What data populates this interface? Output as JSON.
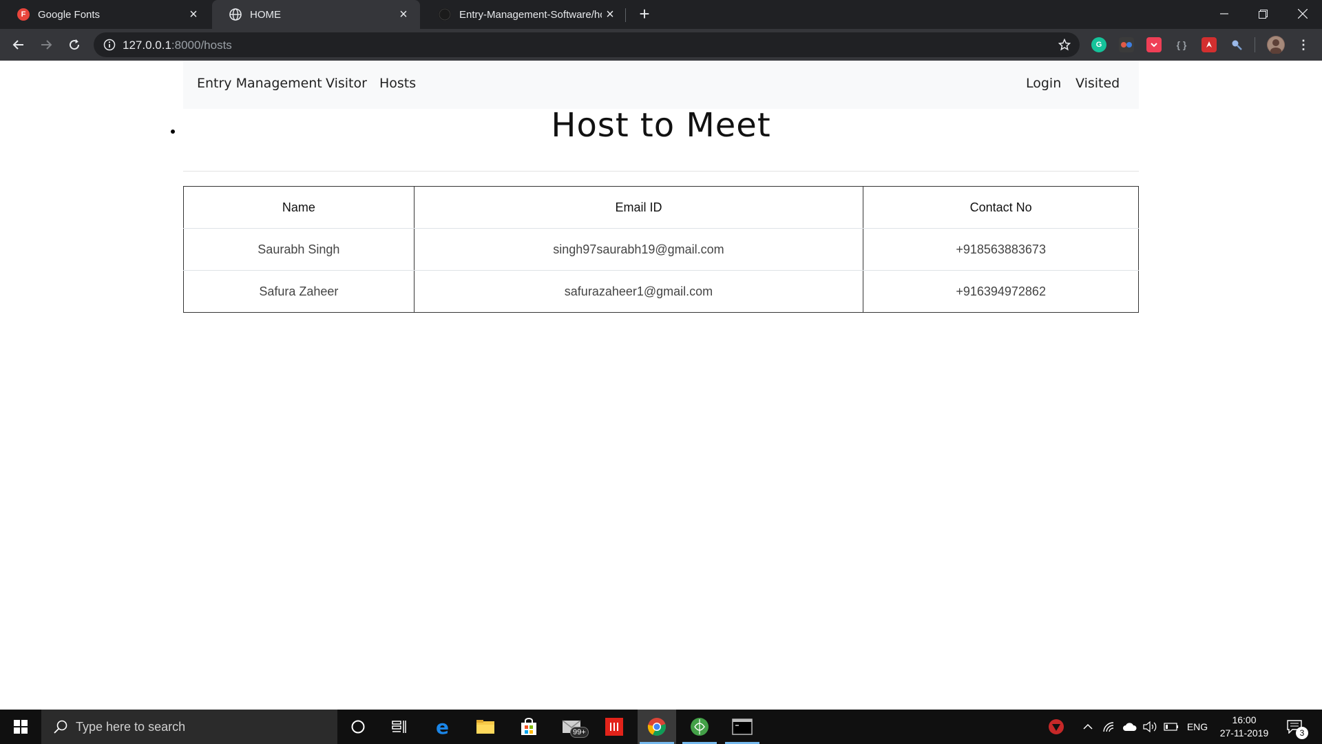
{
  "browser": {
    "tabs": [
      {
        "title": "Google Fonts",
        "favicon_letter": "F",
        "favicon_color": "#e8453c",
        "active": false
      },
      {
        "title": "HOME",
        "favicon": "globe-icon",
        "active": true
      },
      {
        "title": "Entry-Management-Software/hosts",
        "favicon": "github-icon",
        "active": false
      }
    ],
    "address": {
      "host": "127.0.0.1",
      "path": ":8000/hosts"
    }
  },
  "navbar": {
    "brand": "Entry Management",
    "left_links": [
      "Visitor",
      "Hosts"
    ],
    "right_links": [
      "Login",
      "Visited"
    ]
  },
  "page": {
    "heading": "Host to Meet"
  },
  "table": {
    "headers": [
      "Name",
      "Email ID",
      "Contact No"
    ],
    "rows": [
      [
        "Saurabh Singh",
        "singh97saurabh19@gmail.com",
        "+918563883673"
      ],
      [
        "Safura Zaheer",
        "safurazaheer1@gmail.com",
        "+916394972862"
      ]
    ]
  },
  "taskbar": {
    "search_placeholder": "Type here to search",
    "mail_badge": "99+",
    "language": "ENG",
    "time": "16:00",
    "date": "27-11-2019",
    "notification_count": "3"
  },
  "colors": {
    "chrome_dark": "#202124",
    "chrome_toolbar": "#35363a",
    "navbar_bg": "#f8f9fa",
    "taskbar_bg": "#101010",
    "accent_blue": "#76b9ed"
  }
}
